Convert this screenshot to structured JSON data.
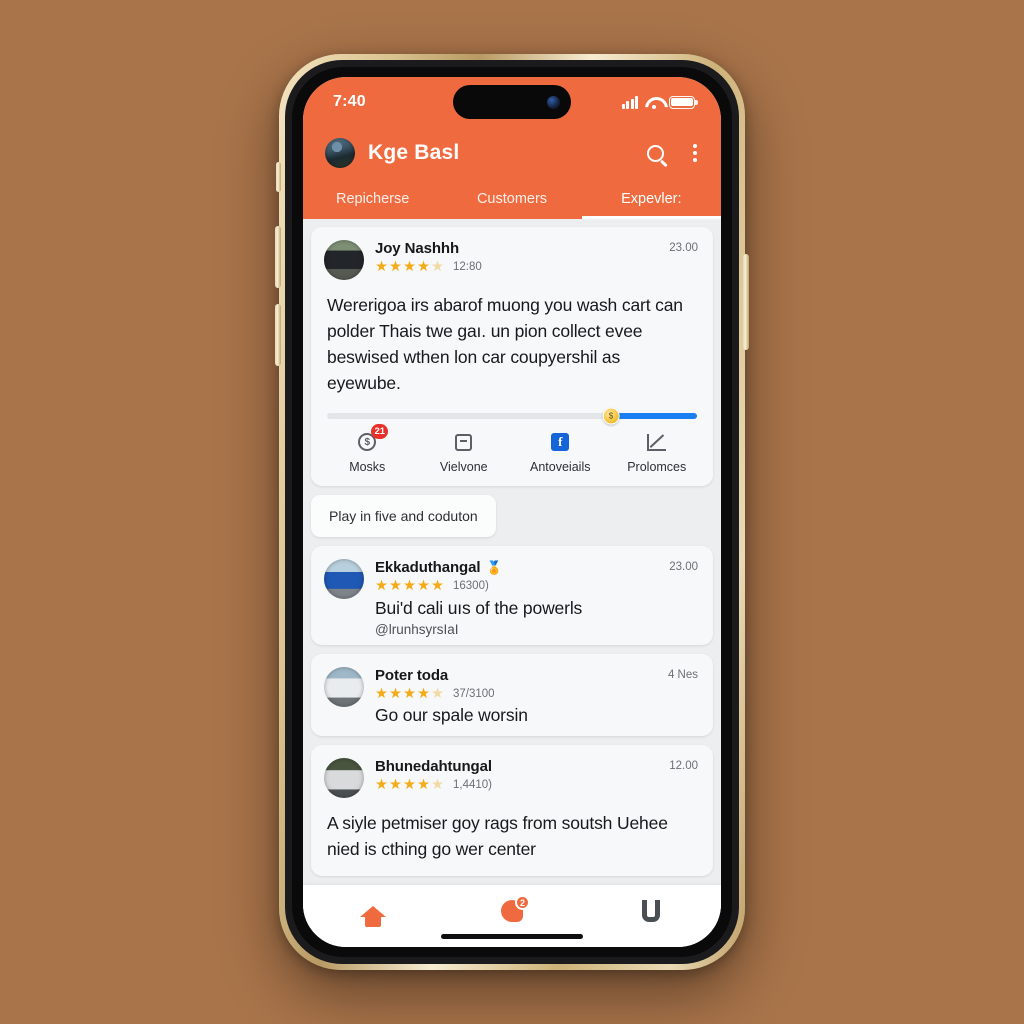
{
  "background_color": "#a9744a",
  "accent_color": "#ef6b3f",
  "status_bar": {
    "time": "7:40",
    "signal_icon": "cellular-signal-icon",
    "wifi_icon": "wifi-icon",
    "battery_icon": "battery-icon"
  },
  "header": {
    "avatar_icon": "profile-avatar",
    "title": "Kge Basl",
    "search_icon": "search-icon",
    "overflow_icon": "more-vertical-icon"
  },
  "tabs": [
    {
      "label": "Repicherse",
      "active": false
    },
    {
      "label": "Customers",
      "active": false
    },
    {
      "label": "Expevler:",
      "active": true
    }
  ],
  "feed": {
    "cards": [
      {
        "author": "Joy Nashhh",
        "verified": "",
        "timestamp": "23.00",
        "stars_filled": 4,
        "stars_total": 5,
        "count": "12:80",
        "avatar_icon": "dark-suv-avatar",
        "body": "Wererigoa irs abarof muong you wash cart can polder Thais twe gaı. un pion collect evee beswised wthen lon car coupyershil as eyewube.",
        "slider": {
          "value_percent": 77,
          "thumb_icon": "coin-thumb-icon",
          "fill_color": "#1a7ff0",
          "track_color": "#e3e6e9"
        },
        "actions": [
          {
            "label": "Mosks",
            "icon": "coin-icon",
            "badge": "21"
          },
          {
            "label": "Vielvone",
            "icon": "card-icon",
            "badge": ""
          },
          {
            "label": "Antoveiails",
            "icon": "facebook-icon",
            "badge": ""
          },
          {
            "label": "Prolomces",
            "icon": "chart-icon",
            "badge": ""
          }
        ]
      },
      {
        "author": "Ekkaduthangal",
        "verified": "🏅",
        "timestamp": "23.00",
        "stars_filled": 5,
        "stars_total": 5,
        "count": "16300)",
        "avatar_icon": "blue-car-avatar",
        "body": "Bui'd cali uıs of the powerls",
        "handle": "@lrunhsyrsIaI"
      },
      {
        "author": "Poter toda",
        "verified": "",
        "timestamp": "4 Nes",
        "stars_filled": 4,
        "stars_total": 5,
        "count": "37/3100",
        "avatar_icon": "white-van-avatar",
        "body": "Go our spale worsin"
      },
      {
        "author": "Bhunedahtungal",
        "verified": "",
        "timestamp": "12.00",
        "stars_filled": 4,
        "stars_total": 5,
        "count": "1,4410)",
        "avatar_icon": "silver-suv-avatar",
        "body": "A siyle petmiser goy rags from soutsh Uehee nied is cthing go wer center"
      }
    ],
    "pill_button": "Play in five and coduton"
  },
  "bottom_nav": [
    {
      "icon": "home-icon",
      "label": ""
    },
    {
      "icon": "chat-icon",
      "label": "",
      "badge": "2"
    },
    {
      "icon": "bookmark-icon",
      "label": ""
    }
  ]
}
